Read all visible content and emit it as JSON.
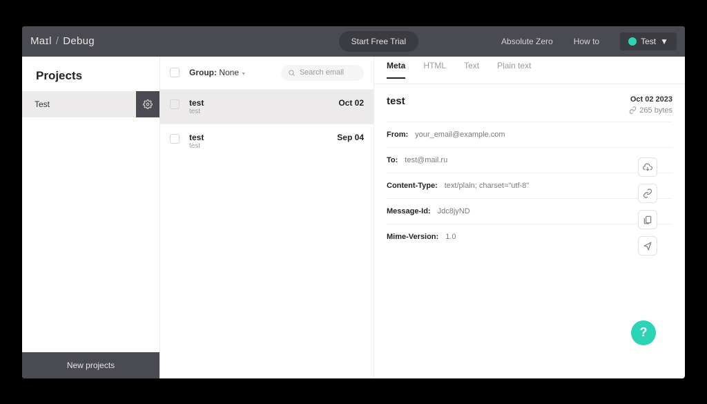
{
  "brand": {
    "part1": "Maɪl",
    "part2": "Debug"
  },
  "topbar": {
    "free_trial": "Start Free Trial",
    "absolute_zero": "Absolute Zero",
    "how_to": "How to",
    "user": "Test"
  },
  "sidebar": {
    "title": "Projects",
    "projects": [
      {
        "name": "Test"
      }
    ],
    "new_projects": "New projects"
  },
  "middle": {
    "group_label": "Group:",
    "group_value": "None",
    "search_placeholder": "Search email",
    "items": [
      {
        "title": "test",
        "sub": "test",
        "date": "Oct 02"
      },
      {
        "title": "test",
        "sub": "test",
        "date": "Sep 04"
      }
    ]
  },
  "detail": {
    "tabs": [
      "Meta",
      "HTML",
      "Text",
      "Plain text"
    ],
    "title": "test",
    "date": "Oct 02 2023",
    "size": "265 bytes",
    "rows": [
      {
        "k": "From:",
        "v": "your_email@example.com"
      },
      {
        "k": "To:",
        "v": "test@mail.ru"
      },
      {
        "k": "Content-Type:",
        "v": "text/plain; charset=\"utf-8\""
      },
      {
        "k": "Message-Id:",
        "v": "Jdc8jyND"
      },
      {
        "k": "Mime-Version:",
        "v": "1.0"
      }
    ]
  },
  "help": "?"
}
